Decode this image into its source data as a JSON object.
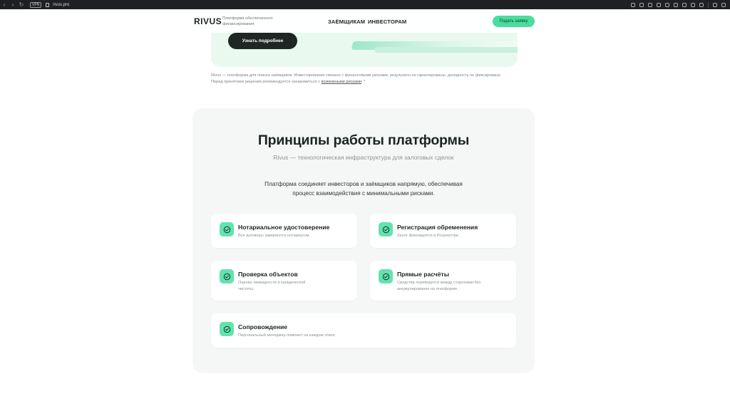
{
  "browser": {
    "vpn_label": "VPN",
    "url": "rivus.pro",
    "nav_icons": [
      "back-arrow",
      "forward-arrow",
      "reload"
    ]
  },
  "header": {
    "logo": "RIVUS",
    "tagline": "Платформа обеспеченного финансирования",
    "nav": [
      "ЗАЁМЩИКАМ",
      "ИНВЕСТОРАМ"
    ],
    "cta": "Подать заявку"
  },
  "hero": {
    "learn_more": "Узнать подробнее"
  },
  "disclaimer": {
    "text": "Rivus — платформа для поиска заёмщиков. Инвестирование связано с финансовыми рисками, результаты не гарантированы, доходность не фиксирована. Перед принятием решения рекомендуется ознакомиться с ",
    "link": "возможными рисками",
    "tail": ". *"
  },
  "principles": {
    "title": "Принципы работы платформы",
    "subtitle": "Rivus — технологическая инфраструктура для залоговых сделок",
    "description": "Платформа соединяет инвесторов и заёмщиков напрямую, обеспечивая процесс взаимодействия с минимальными рисками.",
    "cards": [
      {
        "title": "Нотариальное удостоверение",
        "text": "Все договоры заверяются нотариусом."
      },
      {
        "title": "Регистрация обременения",
        "text": "Залог фиксируется в Росреестре."
      },
      {
        "title": "Проверка объектов",
        "text": "Оценка ликвидности и юридической чистоты."
      },
      {
        "title": "Прямые расчёты",
        "text": "Средства переводятся между сторонами без аккумулирования на платформе."
      },
      {
        "title": "Сопровождение",
        "text": "Персональный менеджер поможет на каждом этапе."
      }
    ]
  },
  "colors": {
    "accent": "#49dd9e",
    "icon_bg": "#63e3ae",
    "dark_button": "#1f2623",
    "section_bg": "#f5f7f7"
  }
}
